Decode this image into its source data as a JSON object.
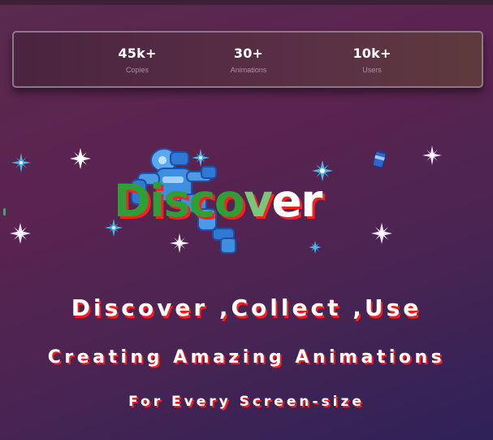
{
  "stats": [
    {
      "value": "45k+",
      "label": "Copies"
    },
    {
      "value": "30+",
      "label": "Animations"
    },
    {
      "value": "10k+",
      "label": "Users"
    }
  ],
  "hero": {
    "word_parts": [
      "Di",
      "sco",
      "v",
      "er"
    ],
    "decorations": [
      "sparkle-icon",
      "robot-icon",
      "can-icon"
    ]
  },
  "taglines": {
    "line1": "Discover ,Collect ,Use",
    "line2": "Creating Amazing Animations",
    "line3": "For Every Screen-size"
  },
  "colors": {
    "background_top": "#5b2350",
    "background_bottom": "#2e2258",
    "shadow_red": "#ff1a1a",
    "word_green": "#2f9e34",
    "word_light_green": "#77c77a",
    "sparkle_blue": "#49b6ea"
  }
}
